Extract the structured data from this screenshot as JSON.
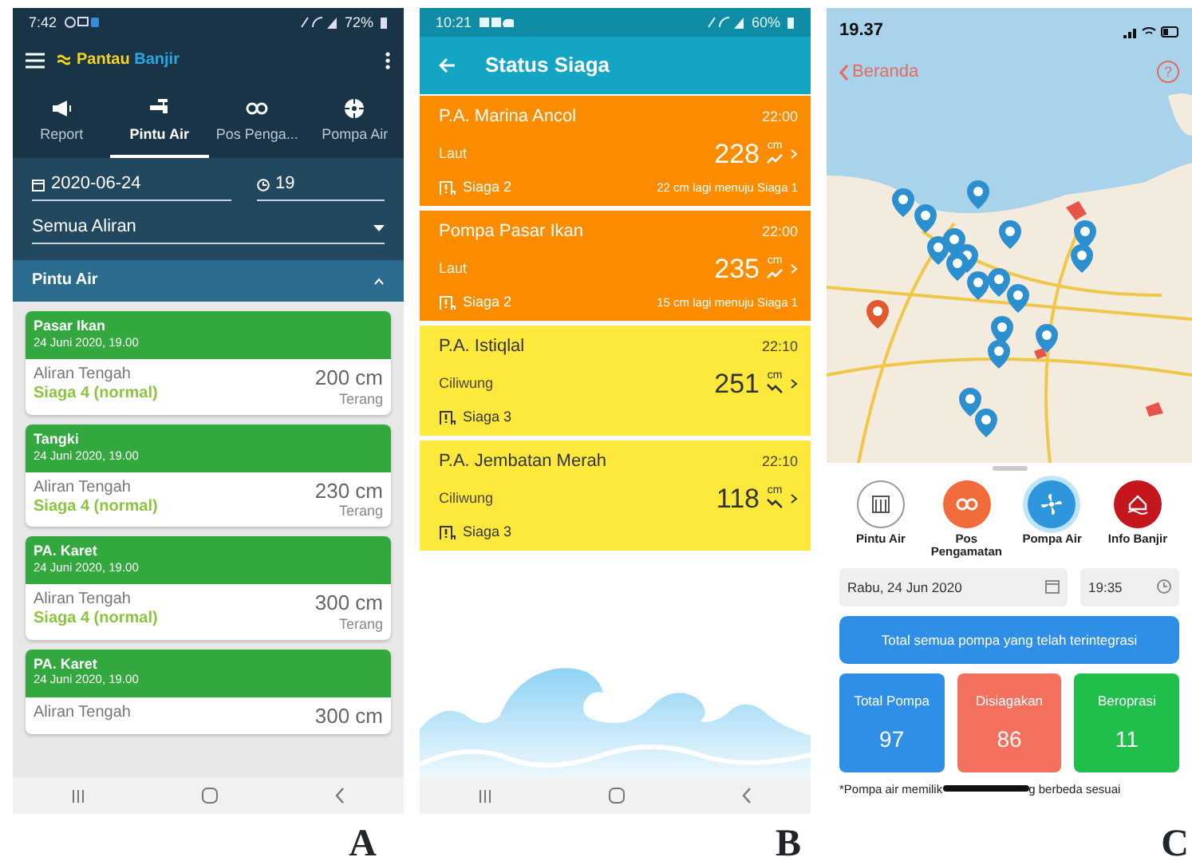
{
  "panel_a": {
    "caption": "A",
    "status_bar": {
      "time": "7:42",
      "battery": "72%"
    },
    "brand": {
      "first": "Pantau",
      "second": "Banjir"
    },
    "tabs": [
      {
        "label": "Report",
        "selected": false
      },
      {
        "label": "Pintu Air",
        "selected": true
      },
      {
        "label": "Pos Penga...",
        "selected": false
      },
      {
        "label": "Pompa Air",
        "selected": false
      }
    ],
    "date": "2020-06-24",
    "hour": "19",
    "river_filter": "Semua Aliran",
    "section": {
      "title": "Pintu Air",
      "expanded": true
    },
    "cards": [
      {
        "name": "Pasar Ikan",
        "date": "24 Juni 2020, 19.00",
        "river": "Aliran Tengah",
        "status": "Siaga 4 (normal)",
        "level": "200 cm",
        "weather": "Terang"
      },
      {
        "name": "Tangki",
        "date": "24 Juni 2020, 19.00",
        "river": "Aliran Tengah",
        "status": "Siaga 4 (normal)",
        "level": "230 cm",
        "weather": "Terang"
      },
      {
        "name": "PA. Karet",
        "date": "24 Juni 2020, 19.00",
        "river": "Aliran Tengah",
        "status": "Siaga 4 (normal)",
        "level": "300 cm",
        "weather": "Terang"
      },
      {
        "name": "PA. Karet",
        "date": "24 Juni 2020, 19.00",
        "river": "Aliran Tengah",
        "level": "300 cm"
      }
    ]
  },
  "panel_b": {
    "caption": "B",
    "status_bar": {
      "time": "10:21",
      "battery": "60%"
    },
    "title": "Status Siaga",
    "items": [
      {
        "name": "P.A. Marina Ancol",
        "river": "Laut",
        "time": "22:00",
        "level": "228",
        "unit": "cm",
        "kind": "rising",
        "alert": "Siaga 2",
        "note": "22 cm lagi menuju Siaga 1",
        "color": "#fb8c00"
      },
      {
        "name": "Pompa Pasar Ikan",
        "river": "Laut",
        "time": "22:00",
        "level": "235",
        "unit": "cm",
        "kind": "rising",
        "alert": "Siaga 2",
        "note": "15 cm lagi menuju Siaga 1",
        "color": "#fb8c00"
      },
      {
        "name": "P.A. Istiqlal",
        "river": "Ciliwung",
        "time": "22:10",
        "level": "251",
        "unit": "cm",
        "kind": "falling",
        "alert": "Siaga 3",
        "color": "#fde93b"
      },
      {
        "name": "P.A. Jembatan Merah",
        "river": "Ciliwung",
        "time": "22:10",
        "level": "118",
        "unit": "cm",
        "kind": "falling",
        "alert": "Siaga 3",
        "color": "#fde93b"
      }
    ]
  },
  "panel_c": {
    "caption": "C",
    "status_bar": {
      "time": "19.37"
    },
    "back_label": "Beranda",
    "help": "?",
    "categories": [
      {
        "label": "Pintu Air",
        "selected": false,
        "color": "#ffffff"
      },
      {
        "label": "Pos Pengamatan",
        "selected": false,
        "color": "#f26b3a"
      },
      {
        "label": "Pompa Air",
        "selected": true,
        "color": "#2d96dc"
      },
      {
        "label": "Info Banjir",
        "selected": false,
        "color": "#c4161c"
      }
    ],
    "date": "Rabu, 24 Jun 2020",
    "time": "19:35",
    "banner": "Total semua pompa yang telah terintegrasi",
    "stats": [
      {
        "label": "Total Pompa",
        "value": "97",
        "color": "#2f8fe6"
      },
      {
        "label": "Disiagakan",
        "value": "86",
        "color": "#f4705e"
      },
      {
        "label": "Beroprasi",
        "value": "11",
        "color": "#20bf4c"
      }
    ],
    "footnote": {
      "before": "*Pompa air memilik",
      "after": "g berbeda sesuai"
    }
  }
}
